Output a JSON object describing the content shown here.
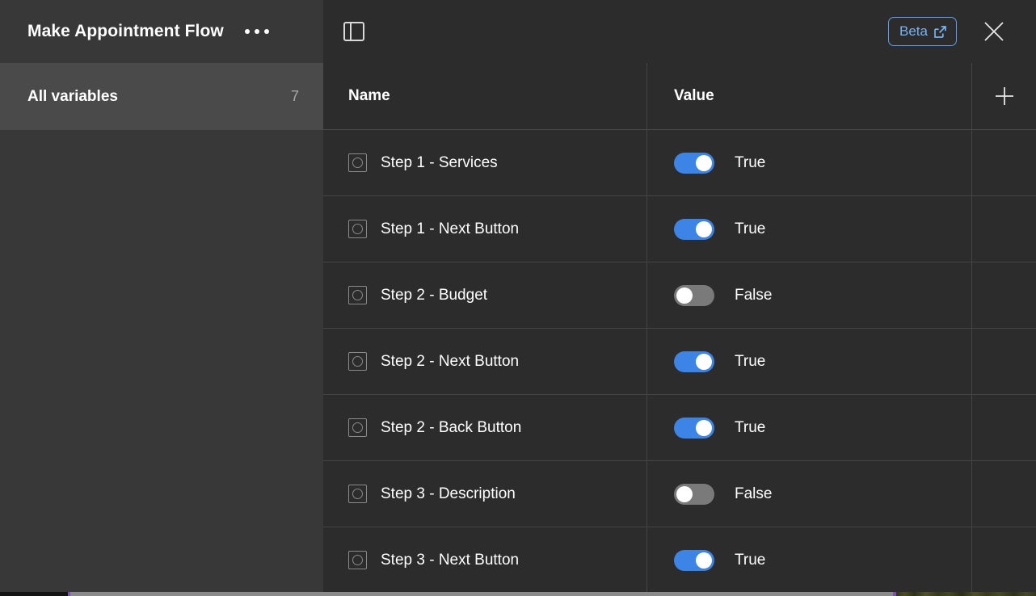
{
  "header": {
    "doc_title": "Make Appointment Flow",
    "more_menu_label": "More options",
    "panel_toggle_label": "Toggle panel",
    "beta_label": "Beta",
    "beta_border_color": "#5b9dec",
    "beta_text_color": "#77b2f2",
    "close_label": "Close"
  },
  "sidebar": {
    "items": [
      {
        "label": "All variables",
        "count": "7",
        "selected": true
      }
    ]
  },
  "table": {
    "columns": [
      {
        "key": "name",
        "label": "Name"
      },
      {
        "key": "value",
        "label": "Value"
      }
    ],
    "add_label": "+",
    "rows": [
      {
        "name": "Step 1 - Services",
        "value": "True",
        "on": true
      },
      {
        "name": "Step 1 - Next Button",
        "value": "True",
        "on": true
      },
      {
        "name": "Step 2 - Budget",
        "value": "False",
        "on": false
      },
      {
        "name": "Step 2 - Next Button",
        "value": "True",
        "on": true
      },
      {
        "name": "Step 2 - Back Button",
        "value": "True",
        "on": true
      },
      {
        "name": "Step 3 - Description",
        "value": "False",
        "on": false
      },
      {
        "name": "Step 3 - Next Button",
        "value": "True",
        "on": true
      }
    ]
  },
  "colors": {
    "toggle_on": "#3c84e6",
    "toggle_off": "#7a7a7a",
    "panel_bg": "#2c2c2c",
    "sidebar_bg": "#383838",
    "sidebar_selected_bg": "#4a4a4a",
    "divider": "#444444"
  }
}
